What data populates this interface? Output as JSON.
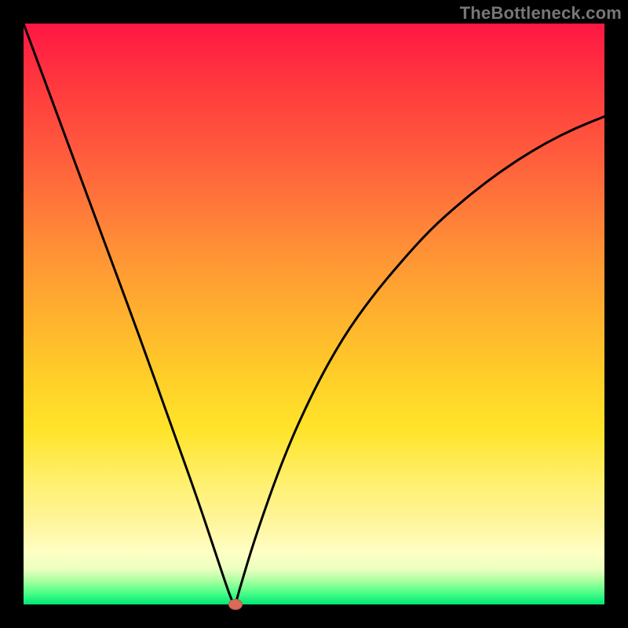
{
  "watermark": "TheBottleneck.com",
  "chart_data": {
    "type": "line",
    "title": "",
    "xlabel": "",
    "ylabel": "",
    "xlim": [
      0,
      100
    ],
    "ylim": [
      0,
      100
    ],
    "grid": false,
    "legend": false,
    "series": [
      {
        "name": "bottleneck-curve",
        "x": [
          0,
          5,
          10,
          15,
          20,
          25,
          30,
          33,
          35,
          36.0,
          36.5,
          37,
          40,
          45,
          50,
          55,
          60,
          65,
          70,
          75,
          80,
          85,
          90,
          95,
          100
        ],
        "values": [
          100,
          86.5,
          73,
          59.5,
          46,
          32,
          18,
          9,
          3,
          0.3,
          0.0,
          2,
          12,
          26,
          37,
          46,
          53,
          59,
          64.5,
          69,
          73,
          76.5,
          79.5,
          82,
          84
        ]
      }
    ],
    "marker": {
      "x": 36.5,
      "y": 0.0
    },
    "background_gradient": {
      "top": "#ff1744",
      "mid": "#ffcc29",
      "bottom": "#00e676"
    }
  }
}
